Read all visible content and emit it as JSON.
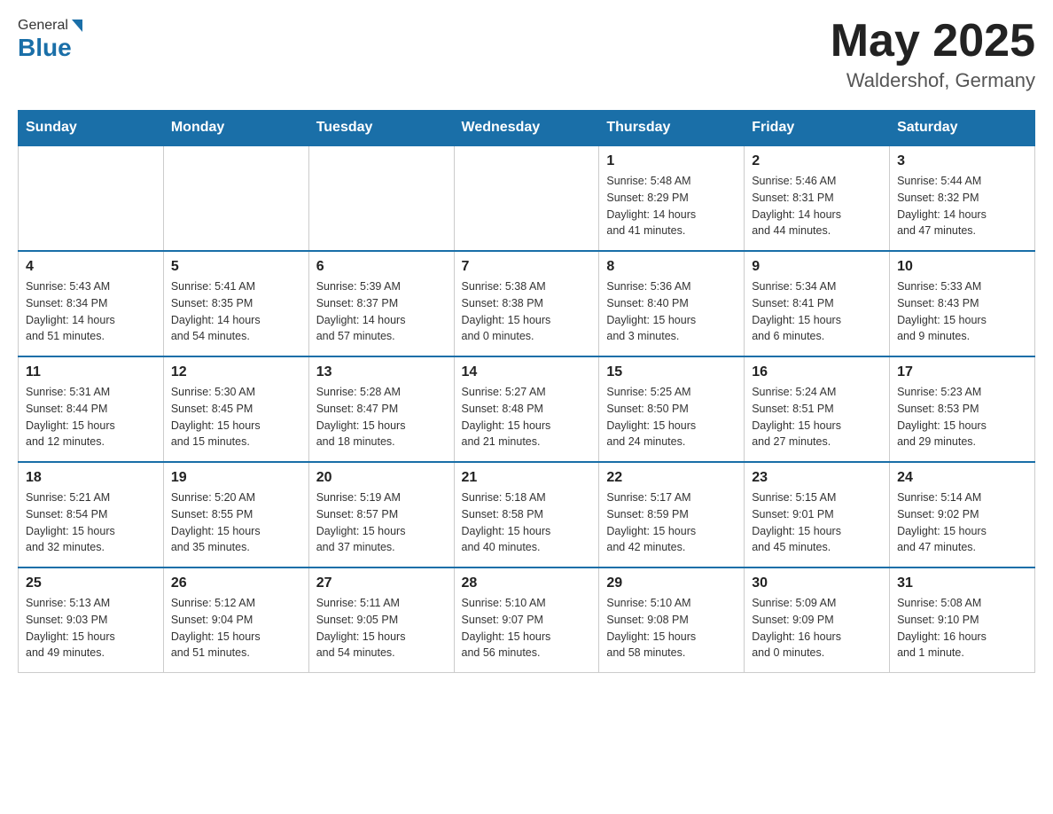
{
  "header": {
    "logo_general": "General",
    "logo_blue": "Blue",
    "title": "May 2025",
    "location": "Waldershof, Germany"
  },
  "days_of_week": [
    "Sunday",
    "Monday",
    "Tuesday",
    "Wednesday",
    "Thursday",
    "Friday",
    "Saturday"
  ],
  "weeks": [
    [
      {
        "day": "",
        "info": ""
      },
      {
        "day": "",
        "info": ""
      },
      {
        "day": "",
        "info": ""
      },
      {
        "day": "",
        "info": ""
      },
      {
        "day": "1",
        "info": "Sunrise: 5:48 AM\nSunset: 8:29 PM\nDaylight: 14 hours\nand 41 minutes."
      },
      {
        "day": "2",
        "info": "Sunrise: 5:46 AM\nSunset: 8:31 PM\nDaylight: 14 hours\nand 44 minutes."
      },
      {
        "day": "3",
        "info": "Sunrise: 5:44 AM\nSunset: 8:32 PM\nDaylight: 14 hours\nand 47 minutes."
      }
    ],
    [
      {
        "day": "4",
        "info": "Sunrise: 5:43 AM\nSunset: 8:34 PM\nDaylight: 14 hours\nand 51 minutes."
      },
      {
        "day": "5",
        "info": "Sunrise: 5:41 AM\nSunset: 8:35 PM\nDaylight: 14 hours\nand 54 minutes."
      },
      {
        "day": "6",
        "info": "Sunrise: 5:39 AM\nSunset: 8:37 PM\nDaylight: 14 hours\nand 57 minutes."
      },
      {
        "day": "7",
        "info": "Sunrise: 5:38 AM\nSunset: 8:38 PM\nDaylight: 15 hours\nand 0 minutes."
      },
      {
        "day": "8",
        "info": "Sunrise: 5:36 AM\nSunset: 8:40 PM\nDaylight: 15 hours\nand 3 minutes."
      },
      {
        "day": "9",
        "info": "Sunrise: 5:34 AM\nSunset: 8:41 PM\nDaylight: 15 hours\nand 6 minutes."
      },
      {
        "day": "10",
        "info": "Sunrise: 5:33 AM\nSunset: 8:43 PM\nDaylight: 15 hours\nand 9 minutes."
      }
    ],
    [
      {
        "day": "11",
        "info": "Sunrise: 5:31 AM\nSunset: 8:44 PM\nDaylight: 15 hours\nand 12 minutes."
      },
      {
        "day": "12",
        "info": "Sunrise: 5:30 AM\nSunset: 8:45 PM\nDaylight: 15 hours\nand 15 minutes."
      },
      {
        "day": "13",
        "info": "Sunrise: 5:28 AM\nSunset: 8:47 PM\nDaylight: 15 hours\nand 18 minutes."
      },
      {
        "day": "14",
        "info": "Sunrise: 5:27 AM\nSunset: 8:48 PM\nDaylight: 15 hours\nand 21 minutes."
      },
      {
        "day": "15",
        "info": "Sunrise: 5:25 AM\nSunset: 8:50 PM\nDaylight: 15 hours\nand 24 minutes."
      },
      {
        "day": "16",
        "info": "Sunrise: 5:24 AM\nSunset: 8:51 PM\nDaylight: 15 hours\nand 27 minutes."
      },
      {
        "day": "17",
        "info": "Sunrise: 5:23 AM\nSunset: 8:53 PM\nDaylight: 15 hours\nand 29 minutes."
      }
    ],
    [
      {
        "day": "18",
        "info": "Sunrise: 5:21 AM\nSunset: 8:54 PM\nDaylight: 15 hours\nand 32 minutes."
      },
      {
        "day": "19",
        "info": "Sunrise: 5:20 AM\nSunset: 8:55 PM\nDaylight: 15 hours\nand 35 minutes."
      },
      {
        "day": "20",
        "info": "Sunrise: 5:19 AM\nSunset: 8:57 PM\nDaylight: 15 hours\nand 37 minutes."
      },
      {
        "day": "21",
        "info": "Sunrise: 5:18 AM\nSunset: 8:58 PM\nDaylight: 15 hours\nand 40 minutes."
      },
      {
        "day": "22",
        "info": "Sunrise: 5:17 AM\nSunset: 8:59 PM\nDaylight: 15 hours\nand 42 minutes."
      },
      {
        "day": "23",
        "info": "Sunrise: 5:15 AM\nSunset: 9:01 PM\nDaylight: 15 hours\nand 45 minutes."
      },
      {
        "day": "24",
        "info": "Sunrise: 5:14 AM\nSunset: 9:02 PM\nDaylight: 15 hours\nand 47 minutes."
      }
    ],
    [
      {
        "day": "25",
        "info": "Sunrise: 5:13 AM\nSunset: 9:03 PM\nDaylight: 15 hours\nand 49 minutes."
      },
      {
        "day": "26",
        "info": "Sunrise: 5:12 AM\nSunset: 9:04 PM\nDaylight: 15 hours\nand 51 minutes."
      },
      {
        "day": "27",
        "info": "Sunrise: 5:11 AM\nSunset: 9:05 PM\nDaylight: 15 hours\nand 54 minutes."
      },
      {
        "day": "28",
        "info": "Sunrise: 5:10 AM\nSunset: 9:07 PM\nDaylight: 15 hours\nand 56 minutes."
      },
      {
        "day": "29",
        "info": "Sunrise: 5:10 AM\nSunset: 9:08 PM\nDaylight: 15 hours\nand 58 minutes."
      },
      {
        "day": "30",
        "info": "Sunrise: 5:09 AM\nSunset: 9:09 PM\nDaylight: 16 hours\nand 0 minutes."
      },
      {
        "day": "31",
        "info": "Sunrise: 5:08 AM\nSunset: 9:10 PM\nDaylight: 16 hours\nand 1 minute."
      }
    ]
  ]
}
